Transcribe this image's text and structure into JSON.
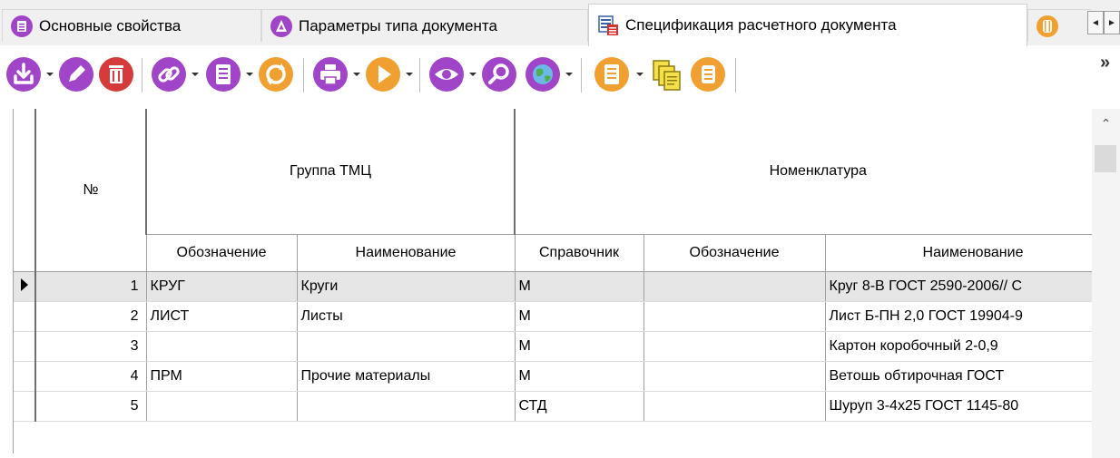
{
  "tabs": [
    {
      "label": "Основные свойства",
      "icon": "list-icon",
      "active": false
    },
    {
      "label": "Параметры типа документа",
      "icon": "triangle-icon",
      "active": false
    },
    {
      "label": "Спецификация расчетного документа",
      "icon": "spec-table-icon",
      "active": true
    }
  ],
  "tab_overflow_icon": "barrel-icon",
  "tab_scroll": {
    "left": "◄",
    "right": "►"
  },
  "toolbar": {
    "more": "»",
    "buttons": [
      {
        "name": "add-icon",
        "color": "#a044c8"
      },
      {
        "name": "edit-icon",
        "color": "#a044c8"
      },
      {
        "name": "delete-icon",
        "color": "#d63b3b"
      },
      {
        "name": "link-icon",
        "color": "#a044c8"
      },
      {
        "name": "document-icon",
        "color": "#a044c8"
      },
      {
        "name": "refresh-icon",
        "color": "#f0a030"
      },
      {
        "name": "print-icon",
        "color": "#a044c8"
      },
      {
        "name": "run-icon",
        "color": "#f0a030"
      },
      {
        "name": "view-icon",
        "color": "#a044c8"
      },
      {
        "name": "search-icon",
        "color": "#a044c8"
      },
      {
        "name": "globe-icon",
        "color": "#a044c8"
      },
      {
        "name": "report-icon",
        "color": "#f0a030"
      },
      {
        "name": "copy-docs-icon",
        "color": "#e8c820"
      },
      {
        "name": "scroll-icon",
        "color": "#f0a030"
      }
    ]
  },
  "grid": {
    "col_num": "№",
    "group_header": "Группа ТМЦ",
    "nom_header": "Номенклатура",
    "sub_headers": {
      "group_code": "Обозначение",
      "group_name": "Наименование",
      "nom_ref": "Справочник",
      "nom_code": "Обозначение",
      "nom_name": "Наименование"
    },
    "rows": [
      {
        "n": "1",
        "group_code": "КРУГ",
        "group_name": "Круги",
        "ref": "М",
        "code": "",
        "name": "Круг 8-В ГОСТ 2590-2006// С"
      },
      {
        "n": "2",
        "group_code": "ЛИСТ",
        "group_name": "Листы",
        "ref": "М",
        "code": "",
        "name": "Лист Б-ПН 2,0 ГОСТ 19904-9"
      },
      {
        "n": "3",
        "group_code": "",
        "group_name": "",
        "ref": "М",
        "code": "",
        "name": "Картон коробочный 2-0,9"
      },
      {
        "n": "4",
        "group_code": "ПРМ",
        "group_name": "Прочие материалы",
        "ref": "М",
        "code": "",
        "name": "Ветошь обтирочная ГОСТ"
      },
      {
        "n": "5",
        "group_code": "",
        "group_name": "",
        "ref": "СТД",
        "code": "",
        "name": "Шуруп 3-4х25 ГОСТ 1145-80"
      }
    ]
  }
}
